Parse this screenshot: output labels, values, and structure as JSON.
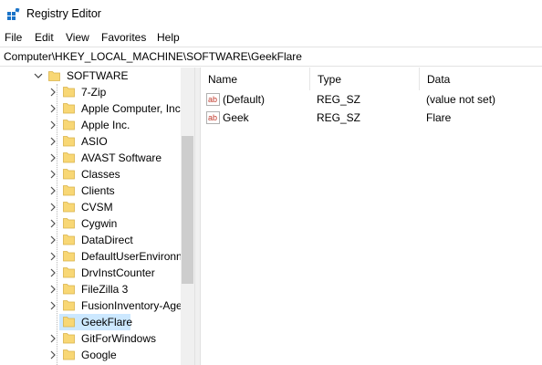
{
  "window": {
    "title": "Registry Editor",
    "icon": "registry-editor-icon"
  },
  "menu": [
    "File",
    "Edit",
    "View",
    "Favorites",
    "Help"
  ],
  "address": "Computer\\HKEY_LOCAL_MACHINE\\SOFTWARE\\GeekFlare",
  "tree": {
    "parent": "SOFTWARE",
    "items": [
      "7-Zip",
      "Apple Computer, Inc",
      "Apple Inc.",
      "ASIO",
      "AVAST Software",
      "Classes",
      "Clients",
      "CVSM",
      "Cygwin",
      "DataDirect",
      "DefaultUserEnvironn",
      "DrvInstCounter",
      "FileZilla 3",
      "FusionInventory-Age",
      "GeekFlare",
      "GitForWindows",
      "Google"
    ],
    "selected": "GeekFlare",
    "selection_color": "#cce8ff",
    "folder_color": "#f8d775"
  },
  "values_table": {
    "columns": [
      "Name",
      "Type",
      "Data"
    ],
    "rows": [
      {
        "name": "(Default)",
        "type": "REG_SZ",
        "data": "(value not set)",
        "icon": "string-value-icon"
      },
      {
        "name": "Geek",
        "type": "REG_SZ",
        "data": "Flare",
        "icon": "string-value-icon"
      }
    ]
  }
}
